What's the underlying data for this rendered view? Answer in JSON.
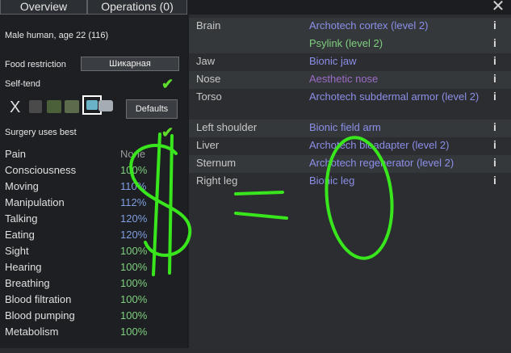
{
  "tabs": {
    "overview": "Overview",
    "operations": "Operations (0)"
  },
  "pawn_summary": "Male human, age 22 (116)",
  "food_restriction": {
    "label": "Food restriction",
    "value": "Шикарная"
  },
  "self_tend": {
    "label": "Self-tend"
  },
  "defaults_button": "Defaults",
  "surgery_uses_best": {
    "label": "Surgery uses best"
  },
  "capacities": [
    {
      "name": "Pain",
      "value": "None",
      "tone": "none"
    },
    {
      "name": "Consciousness",
      "value": "100%",
      "tone": "green"
    },
    {
      "name": "Moving",
      "value": "110%",
      "tone": "blue"
    },
    {
      "name": "Manipulation",
      "value": "112%",
      "tone": "blue"
    },
    {
      "name": "Talking",
      "value": "120%",
      "tone": "blue"
    },
    {
      "name": "Eating",
      "value": "120%",
      "tone": "blue"
    },
    {
      "name": "Sight",
      "value": "100%",
      "tone": "green"
    },
    {
      "name": "Hearing",
      "value": "100%",
      "tone": "green"
    },
    {
      "name": "Breathing",
      "value": "100%",
      "tone": "green"
    },
    {
      "name": "Blood filtration",
      "value": "100%",
      "tone": "green"
    },
    {
      "name": "Blood pumping",
      "value": "100%",
      "tone": "green"
    },
    {
      "name": "Metabolism",
      "value": "100%",
      "tone": "green"
    }
  ],
  "hediffs": [
    {
      "part": "Brain",
      "items": [
        "Archotech cortex (level 2)",
        "Psylink (level 2)"
      ]
    },
    {
      "part": "Jaw",
      "items": [
        "Bionic jaw"
      ]
    },
    {
      "part": "Nose",
      "items": [
        "Aesthetic nose"
      ]
    },
    {
      "part": "Torso",
      "items": [
        "Archotech subdermal armor (level 2)"
      ]
    },
    {
      "part": "Left shoulder",
      "items": [
        "Bionic field arm"
      ]
    },
    {
      "part": "Liver",
      "items": [
        "Archotech bioadapter (level 2)"
      ]
    },
    {
      "part": "Sternum",
      "items": [
        "Archotech regenerator (level 2)"
      ]
    },
    {
      "part": "Right leg",
      "items": [
        "Bionic leg"
      ]
    }
  ],
  "icons": {
    "close": "close-icon",
    "check": "checkmark-icon",
    "info": "info-icon"
  },
  "colors": {
    "check": "#5fdc2b",
    "bionic_blue": "#8c8fe8",
    "green_text": "#7fd07f",
    "psylink_green": "#7fcf7f",
    "nose_purple": "#9b6cc7",
    "annotation": "#39e51c"
  }
}
